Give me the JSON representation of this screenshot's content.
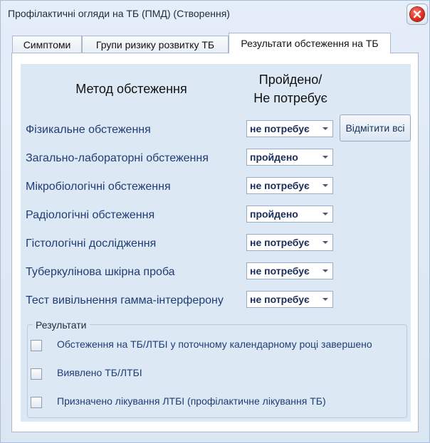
{
  "window": {
    "title": "Профілактичні огляди на ТБ (ПМД) (Створення)"
  },
  "tabs": [
    {
      "label": "Симптоми"
    },
    {
      "label": "Групи ризику розвитку ТБ"
    },
    {
      "label": "Результати обстеження на ТБ",
      "active": true
    }
  ],
  "table": {
    "header_method": "Метод обстеження",
    "header_status_line1": "Пройдено/",
    "header_status_line2": "Не потребує",
    "rows": [
      {
        "method": "Фізикальне обстеження",
        "status": "не потребує"
      },
      {
        "method": "Загально-лабораторні обстеження",
        "status": "пройдено"
      },
      {
        "method": "Мікробіологічні обстеження",
        "status": "не потребує"
      },
      {
        "method": "Радіологічні обстеження",
        "status": "пройдено"
      },
      {
        "method": "Гістологічні дослідження",
        "status": "не потребує"
      },
      {
        "method": "Туберкулінова шкірна проба",
        "status": "не потребує"
      },
      {
        "method": "Тест вивільнення гамма-інтерферону",
        "status": "не потребує"
      }
    ]
  },
  "mark_all_label": "Відмітити всі",
  "results": {
    "title": "Результати",
    "items": [
      {
        "label": "Обстеження на ТБ/ЛТБІ у поточному календарному році завершено",
        "checked": false
      },
      {
        "label": "Виявлено ТБ/ЛТБІ",
        "checked": false
      },
      {
        "label": "Призначено лікування ЛТБІ (профілактичне лікування ТБ)",
        "checked": false
      }
    ]
  }
}
